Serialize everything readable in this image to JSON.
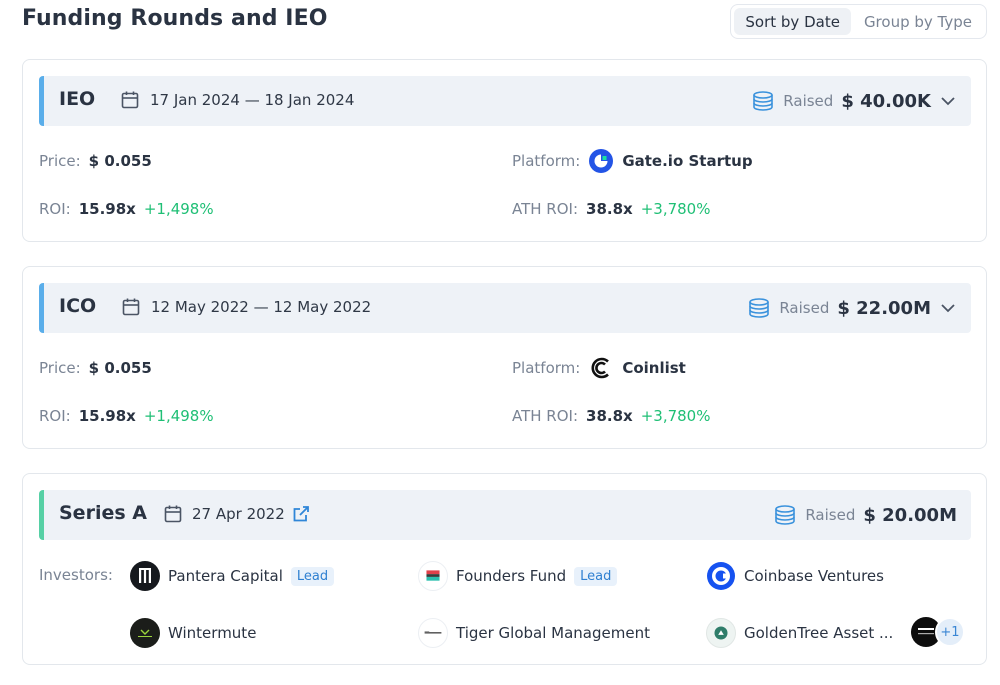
{
  "page": {
    "title": "Funding Rounds and IEO"
  },
  "sort": {
    "options": [
      "Sort by Date",
      "Group by Type"
    ],
    "active": "Sort by Date"
  },
  "rounds": [
    {
      "type": "IEO",
      "dates": "17 Jan 2024 — 18 Jan 2024",
      "raised_label": "Raised",
      "raised": "$ 40.00K",
      "price_label": "Price:",
      "price": "$ 0.055",
      "platform_label": "Platform:",
      "platform": "Gate.io Startup",
      "roi_label": "ROI:",
      "roi": "15.98x",
      "roi_pct": "+1,498%",
      "ath_roi_label": "ATH ROI:",
      "ath_roi": "38.8x",
      "ath_roi_pct": "+3,780%"
    },
    {
      "type": "ICO",
      "dates": "12 May 2022 — 12 May 2022",
      "raised_label": "Raised",
      "raised": "$ 22.00M",
      "price_label": "Price:",
      "price": "$ 0.055",
      "platform_label": "Platform:",
      "platform": "Coinlist",
      "roi_label": "ROI:",
      "roi": "15.98x",
      "roi_pct": "+1,498%",
      "ath_roi_label": "ATH ROI:",
      "ath_roi": "38.8x",
      "ath_roi_pct": "+3,780%"
    },
    {
      "type": "Series A",
      "dates": "27 Apr 2022",
      "raised_label": "Raised",
      "raised": "$ 20.00M",
      "investors_label": "Investors:",
      "investors": [
        {
          "name": "Pantera Capital",
          "lead": "Lead"
        },
        {
          "name": "Founders Fund",
          "lead": "Lead"
        },
        {
          "name": "Coinbase Ventures"
        },
        {
          "name": "Wintermute"
        },
        {
          "name": "Tiger Global Management"
        },
        {
          "name": "GoldenTree Asset ..."
        }
      ],
      "more_count": "+1"
    }
  ],
  "colors": {
    "accent_blue": "#5aaeea",
    "accent_green": "#56d0a5",
    "positive": "#1fbf75",
    "lead_bg": "#e8f1fb"
  }
}
